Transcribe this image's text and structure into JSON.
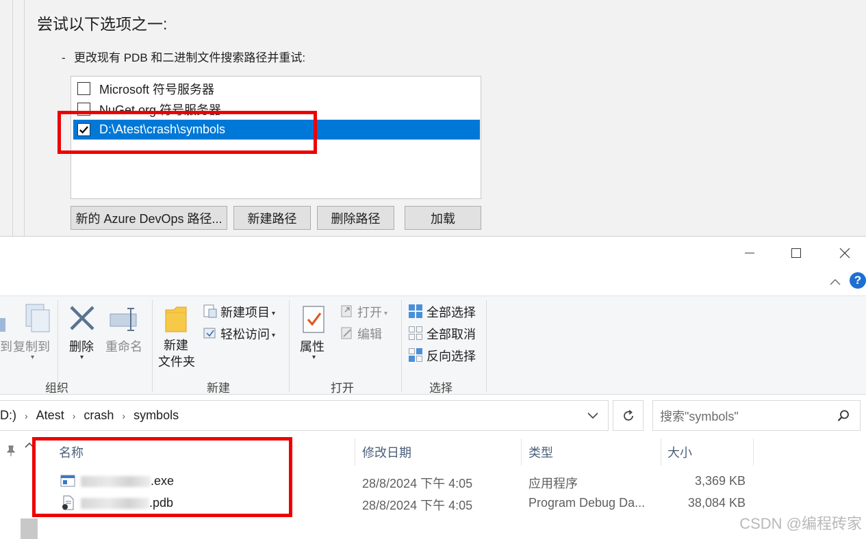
{
  "vs_panel": {
    "heading": "尝试以下选项之一:",
    "bullet_dash": "-",
    "bullet_text": "更改现有 PDB 和二进制文件搜索路径并重试:",
    "search_paths": [
      {
        "label": "Microsoft 符号服务器",
        "checked": false,
        "selected": false
      },
      {
        "label": "NuGet.org 符号服务器",
        "checked": false,
        "selected": false
      },
      {
        "label": "D:\\Atest\\crash\\symbols",
        "checked": true,
        "selected": true
      }
    ],
    "buttons": {
      "azure": "新的 Azure DevOps 路径...",
      "new_path": "新建路径",
      "delete_path": "删除路径",
      "load": "加载"
    }
  },
  "explorer": {
    "ribbon": {
      "organize": {
        "label": "组织",
        "cut_partial": "到",
        "copy_to": "复制到",
        "delete": "删除",
        "rename": "重命名"
      },
      "new": {
        "label": "新建",
        "new_folder_line1": "新建",
        "new_folder_line2": "文件夹",
        "new_item": "新建项目",
        "easy_access": "轻松访问"
      },
      "open": {
        "label": "打开",
        "properties": "属性",
        "open": "打开",
        "edit": "编辑"
      },
      "select": {
        "label": "选择",
        "select_all": "全部选择",
        "select_none": "全部取消",
        "invert": "反向选择"
      }
    },
    "address": {
      "crumbs": [
        "D:)",
        "Atest",
        "crash",
        "symbols"
      ]
    },
    "search": {
      "placeholder": "搜索\"symbols\""
    },
    "columns": {
      "name": "名称",
      "modified": "修改日期",
      "type": "类型",
      "size": "大小"
    },
    "files": [
      {
        "name_suffix": ".exe",
        "modified": "28/8/2024 下午 4:05",
        "type": "应用程序",
        "size": "3,369 KB",
        "icon": "exe-file-icon"
      },
      {
        "name_suffix": ".pdb",
        "modified": "28/8/2024 下午 4:05",
        "type": "Program Debug Da...",
        "size": "38,084 KB",
        "icon": "pdb-file-icon"
      }
    ]
  },
  "watermark": "CSDN @编程砖家",
  "colors": {
    "selection": "#0078d7",
    "highlight_box": "#ee0000",
    "ribbon_bg": "#f5f6f7"
  }
}
